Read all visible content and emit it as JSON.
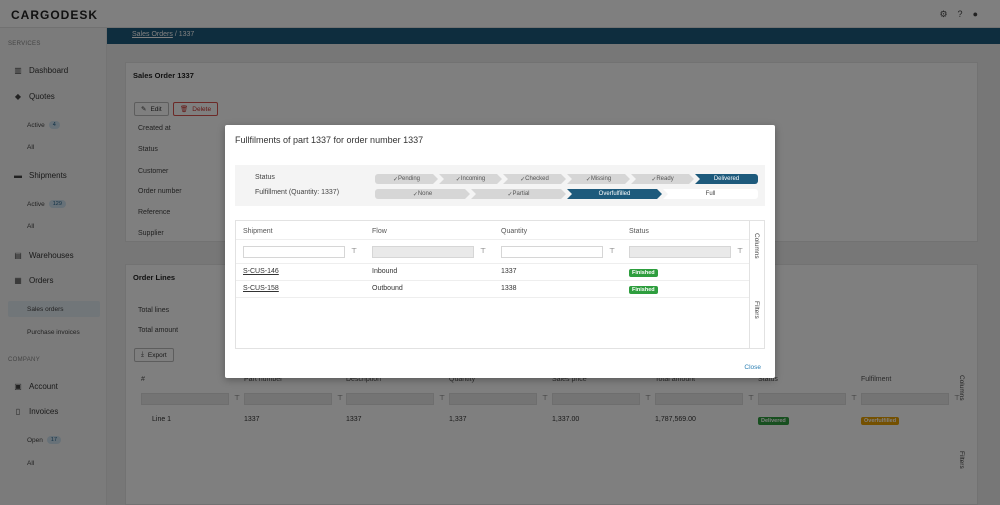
{
  "app": {
    "logo": "CARGODESK",
    "icons": [
      "gear-icon",
      "help-icon",
      "user-icon"
    ]
  },
  "sidebar": {
    "services_label": "SERVICES",
    "company_label": "COMPANY",
    "dashboard": "Dashboard",
    "quotes": "Quotes",
    "quotes_active": "Active",
    "quotes_active_count": "4",
    "quotes_all": "All",
    "shipments": "Shipments",
    "shipments_active": "Active",
    "shipments_active_count": "129",
    "shipments_all": "All",
    "warehouses": "Warehouses",
    "orders": "Orders",
    "sales_orders": "Sales orders",
    "purchase_invoices": "Purchase invoices",
    "account": "Account",
    "invoices": "Invoices",
    "invoices_open": "Open",
    "invoices_open_count": "17",
    "invoices_all": "All"
  },
  "breadcrumb": {
    "parent": "Sales Orders",
    "sep": "/",
    "current": "1337"
  },
  "order": {
    "title": "Sales Order 1337",
    "edit": "Edit",
    "delete": "Delete",
    "fields": [
      "Created at",
      "Status",
      "Customer",
      "Order number",
      "Reference",
      "Supplier"
    ]
  },
  "lines": {
    "title": "Order Lines",
    "total_lines": "Total lines",
    "total_amount": "Total amount",
    "export": "Export",
    "headers": [
      "#",
      "Part number",
      "Description",
      "Quantity",
      "Sales price",
      "Total amount",
      "Status",
      "Fulfilment"
    ],
    "row": {
      "num": "Line 1",
      "part": "1337",
      "desc": "1337",
      "qty": "1,337",
      "price": "1,337.00",
      "total": "1,787,569.00",
      "status": "Delivered",
      "fulfilment": "Overfulfilled"
    },
    "columns_tab": "Columns",
    "filters_tab": "Filters"
  },
  "modal": {
    "title": "Fullfilments of part 1337 for order number 1337",
    "status_label": "Status",
    "status_steps": [
      "Pending",
      "Incoming",
      "Checked",
      "Missing",
      "Ready",
      "Delivered"
    ],
    "fulfillment_label": "Fulfillment (Quantity: 1337)",
    "fulfillment_steps": [
      "None",
      "Partial",
      "Overfulfilled",
      "Full"
    ],
    "headers": [
      "Shipment",
      "Flow",
      "Quantity",
      "Status"
    ],
    "rows": [
      {
        "shipment": "S-CUS-146",
        "flow": "Inbound",
        "quantity": "1337",
        "status": "Finished"
      },
      {
        "shipment": "S-CUS-158",
        "flow": "Outbound",
        "quantity": "1338",
        "status": "Finished"
      }
    ],
    "columns_tab": "Columns",
    "filters_tab": "Filters",
    "close": "Close"
  },
  "colors": {
    "brand": "#1d5a7c",
    "finished": "#2e9e3e",
    "overfulfilled": "#e8a000",
    "delete": "#d9534f"
  }
}
